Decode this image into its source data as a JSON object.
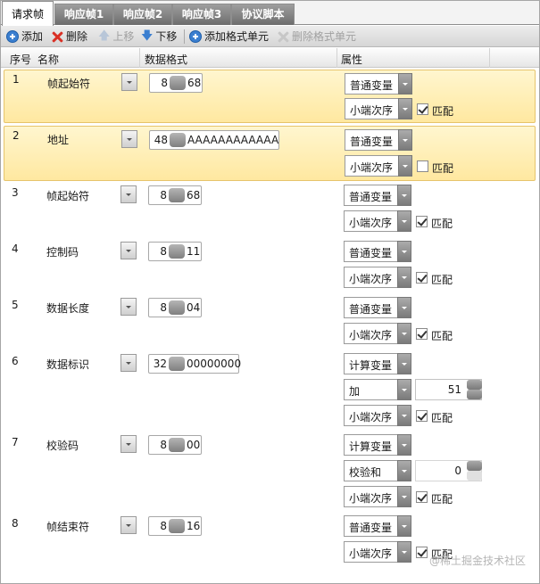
{
  "tabs": [
    "请求帧",
    "响应帧1",
    "响应帧2",
    "响应帧3",
    "协议脚本"
  ],
  "toolbar": {
    "add": "添加",
    "delete": "删除",
    "move_up": "上移",
    "move_down": "下移",
    "add_cell": "添加格式单元",
    "delete_cell": "删除格式单元"
  },
  "columns": {
    "index": "序号",
    "name": "名称",
    "format": "数据格式",
    "attr": "属性"
  },
  "rows": [
    {
      "index": "1",
      "name": "帧起始符",
      "bits": "8",
      "value": "68",
      "var": "普通变量",
      "order": "小端次序",
      "match": true,
      "match_label": "匹配"
    },
    {
      "index": "2",
      "name": "地址",
      "bits": "48",
      "value": "AAAAAAAAAAAA",
      "var": "普通变量",
      "order": "小端次序",
      "match": false,
      "match_label": "匹配"
    },
    {
      "index": "3",
      "name": "帧起始符",
      "bits": "8",
      "value": "68",
      "var": "普通变量",
      "order": "小端次序",
      "match": true,
      "match_label": "匹配"
    },
    {
      "index": "4",
      "name": "控制码",
      "bits": "8",
      "value": "11",
      "var": "普通变量",
      "order": "小端次序",
      "match": true,
      "match_label": "匹配"
    },
    {
      "index": "5",
      "name": "数据长度",
      "bits": "8",
      "value": "04",
      "var": "普通变量",
      "order": "小端次序",
      "match": true,
      "match_label": "匹配"
    },
    {
      "index": "6",
      "name": "数据标识",
      "bits": "32",
      "value": "00000000",
      "var": "计算变量",
      "calc": "加",
      "calc_value": "51",
      "order": "小端次序",
      "match": true,
      "match_label": "匹配"
    },
    {
      "index": "7",
      "name": "校验码",
      "bits": "8",
      "value": "00",
      "var": "计算变量",
      "calc": "校验和",
      "calc_value": "0",
      "order": "小端次序",
      "match": true,
      "match_label": "匹配"
    },
    {
      "index": "8",
      "name": "帧结束符",
      "bits": "8",
      "value": "16",
      "var": "普通变量",
      "order": "小端次序",
      "match": true,
      "match_label": "匹配"
    }
  ],
  "watermark": "@稀土掘金技术社区"
}
